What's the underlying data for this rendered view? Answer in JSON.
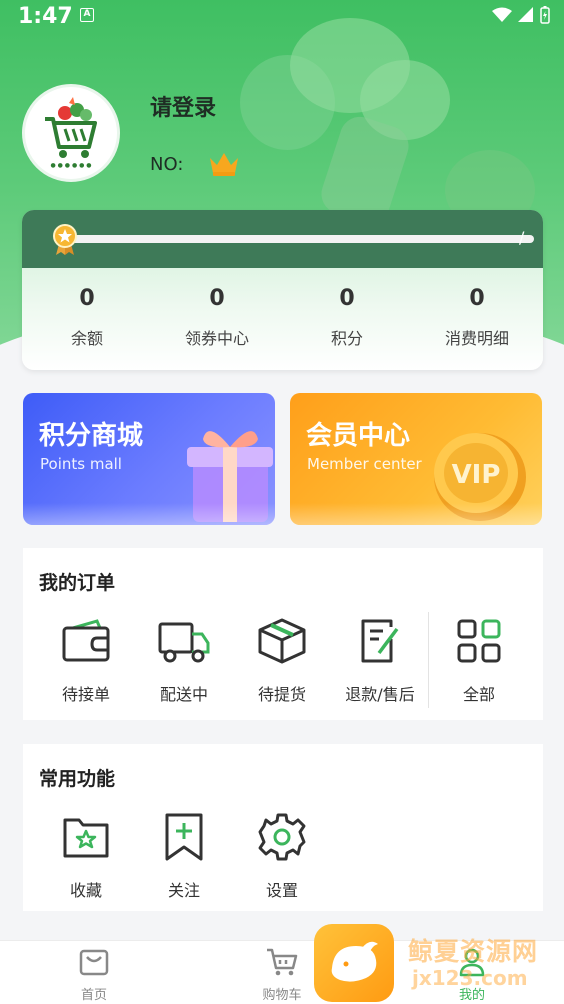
{
  "status_bar": {
    "time": "1:47",
    "a_icon": "A"
  },
  "profile": {
    "login_prompt": "请登录",
    "no_label": "NO:"
  },
  "progress": {
    "fraction": 0.0,
    "separator": "/"
  },
  "stats": [
    {
      "value": "0",
      "label": "余额"
    },
    {
      "value": "0",
      "label": "领券中心"
    },
    {
      "value": "0",
      "label": "积分"
    },
    {
      "value": "0",
      "label": "消费明细"
    }
  ],
  "promos": {
    "points": {
      "title": "积分商城",
      "subtitle": "Points mall"
    },
    "member": {
      "title": "会员中心",
      "subtitle": "Member center"
    }
  },
  "orders": {
    "title": "我的订单",
    "items": [
      {
        "label": "待接单",
        "icon": "wallet-icon"
      },
      {
        "label": "配送中",
        "icon": "truck-icon"
      },
      {
        "label": "待提货",
        "icon": "package-icon"
      },
      {
        "label": "退款/售后",
        "icon": "refund-doc-icon"
      },
      {
        "label": "全部",
        "icon": "grid-icon"
      }
    ]
  },
  "functions": {
    "title": "常用功能",
    "items": [
      {
        "label": "收藏",
        "icon": "star-folder-icon"
      },
      {
        "label": "关注",
        "icon": "bookmark-plus-icon"
      },
      {
        "label": "设置",
        "icon": "gear-icon"
      }
    ]
  },
  "bottom_nav": [
    {
      "label": "首页",
      "icon": "home-bag-icon"
    },
    {
      "label": "购物车",
      "icon": "cart-icon"
    },
    {
      "label": "我的",
      "icon": "user-icon",
      "active": true
    }
  ],
  "watermark": {
    "text": "鲸夏资源网",
    "url": "jx123.com"
  },
  "colors": {
    "primary_green": "#3cb55c",
    "points_blue": "#4a62f8",
    "member_orange": "#ffa726"
  }
}
